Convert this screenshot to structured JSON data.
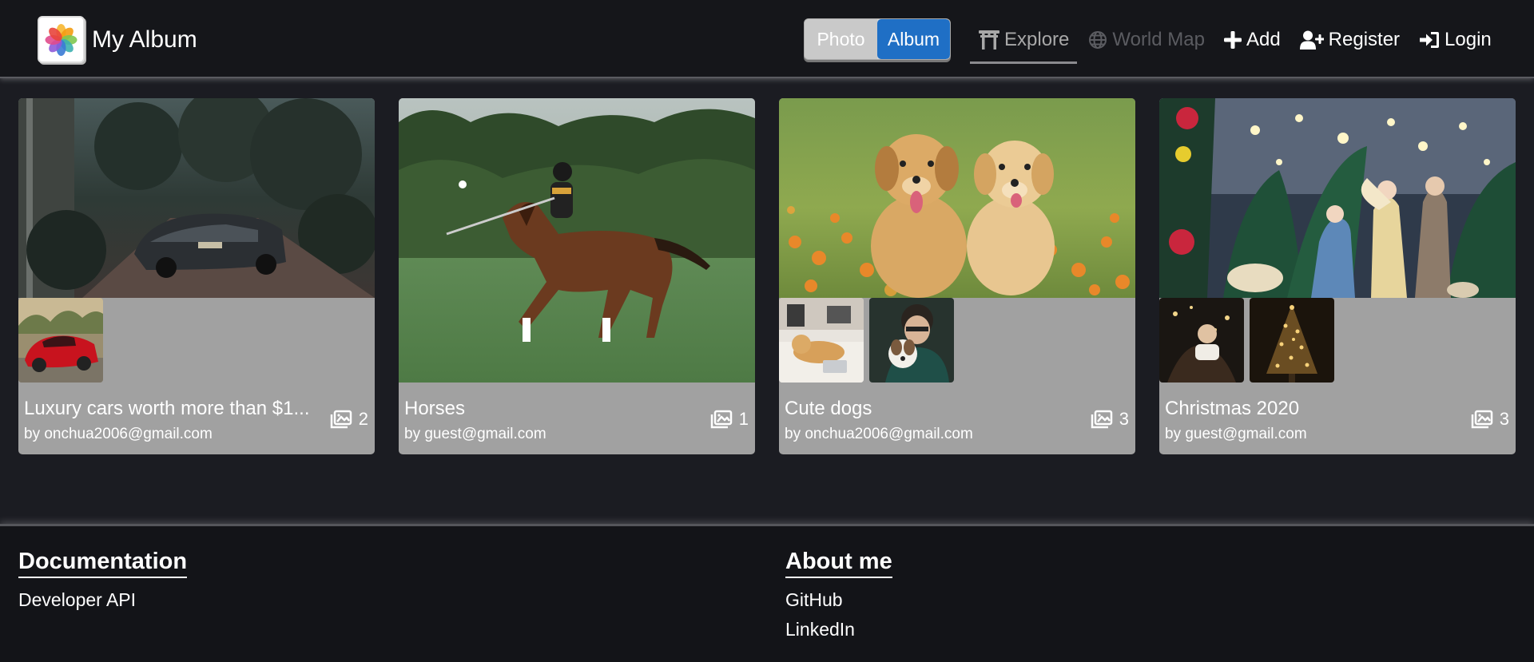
{
  "brand": {
    "title": "My Album",
    "logo_icon": "photos-app-icon"
  },
  "view_toggle": {
    "photo_label": "Photo",
    "album_label": "Album",
    "selected": "Album"
  },
  "nav": {
    "explore": "Explore",
    "world_map": "World Map",
    "add": "Add",
    "register": "Register",
    "login": "Login"
  },
  "albums": [
    {
      "title": "Luxury cars worth more than $1...",
      "author": "by onchua2006@gmail.com",
      "count": "2"
    },
    {
      "title": "Horses",
      "author": "by guest@gmail.com",
      "count": "1"
    },
    {
      "title": "Cute dogs",
      "author": "by onchua2006@gmail.com",
      "count": "3"
    },
    {
      "title": "Christmas 2020",
      "author": "by guest@gmail.com",
      "count": "3"
    }
  ],
  "footer": {
    "documentation": {
      "heading": "Documentation",
      "links": [
        "Developer API"
      ]
    },
    "about": {
      "heading": "About me",
      "links": [
        "GitHub",
        "LinkedIn"
      ]
    }
  },
  "colors": {
    "accent": "#1f6fc5",
    "card_bg": "#a1a1a1",
    "page_bg": "#1b1c22",
    "navbar_bg": "#15161a"
  }
}
